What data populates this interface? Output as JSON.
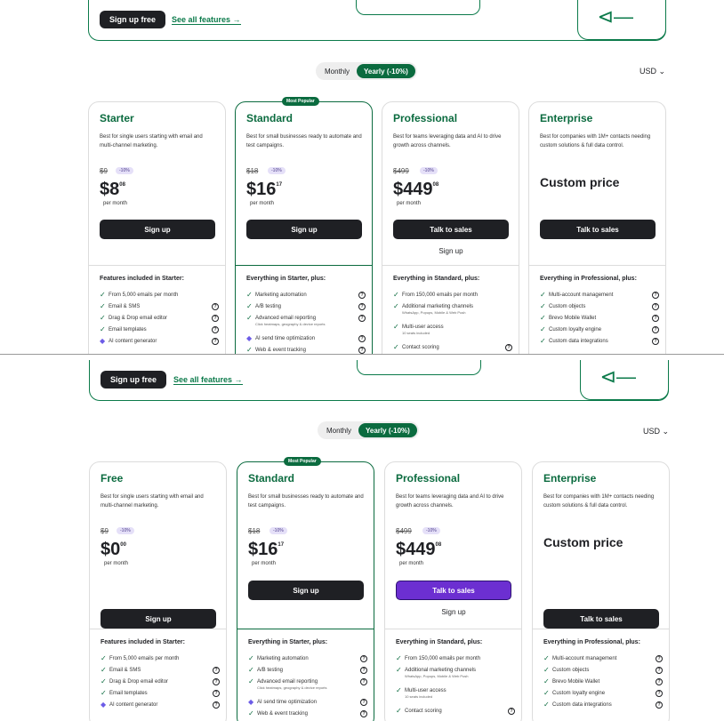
{
  "hero": {
    "signup_label": "Sign up free",
    "features_link": "See all features →"
  },
  "billing_toggle": {
    "monthly": "Monthly",
    "yearly": "Yearly (-10%)"
  },
  "currency": "USD",
  "popular_badge": "Most Popular",
  "top_plans": [
    {
      "name": "Starter",
      "desc": "Best for single users starting with email and multi-channel marketing.",
      "old": "$9",
      "disc": "-10%",
      "price": "$8",
      "cents": "08",
      "per": "per month",
      "cta": "Sign up",
      "ftitle": "Features included in Starter:",
      "features": [
        {
          "text": "From 5,000 emails per month",
          "sub": "",
          "info": ""
        },
        {
          "text": "Email & SMS",
          "sub": "",
          "info": "?"
        },
        {
          "text": "Drag & Drop email editor",
          "sub": "",
          "info": "?"
        },
        {
          "text": "Email templates",
          "sub": "",
          "info": "?"
        },
        {
          "text": "AI content generator",
          "sub": "",
          "info": "?"
        }
      ]
    },
    {
      "name": "Standard",
      "desc": "Best for small businesses ready to automate and test campaigns.",
      "old": "$18",
      "disc": "-10%",
      "price": "$16",
      "cents": "17",
      "per": "per month",
      "cta": "Sign up",
      "ftitle": "Everything in Starter, plus:",
      "features": [
        {
          "text": "Marketing automation",
          "sub": "",
          "info": "?"
        },
        {
          "text": "A/B testing",
          "sub": "",
          "info": "?"
        },
        {
          "text": "Advanced email reporting",
          "sub": "Click heatmaps, geography & device reports",
          "info": "?"
        },
        {
          "text": "AI send time optimization",
          "sub": "",
          "info": "?"
        },
        {
          "text": "Web & event tracking",
          "sub": "",
          "info": "?"
        }
      ]
    },
    {
      "name": "Professional",
      "desc": "Best for teams leveraging data and AI to drive growth across channels.",
      "old": "$499",
      "disc": "-10%",
      "price": "$449",
      "cents": "08",
      "per": "per month",
      "cta": "Talk to sales",
      "cta2": "Sign up",
      "ftitle": "Everything in Standard, plus:",
      "features": [
        {
          "text": "From 150,000 emails per month",
          "sub": "",
          "info": ""
        },
        {
          "text": "Additional marketing channels",
          "sub": "WhatsApp, Popups, Mobile & Web Push",
          "info": ""
        },
        {
          "text": "Multi-user access",
          "sub": "10 seats included",
          "info": ""
        },
        {
          "text": "Contact scoring",
          "sub": "",
          "info": "?"
        }
      ]
    },
    {
      "name": "Enterprise",
      "desc": "Best for companies with 1M+ contacts needing custom solutions & full data control.",
      "custom": "Custom price",
      "cta": "Talk to sales",
      "ftitle": "Everything in Professional, plus:",
      "features": [
        {
          "text": "Multi-account management",
          "sub": "",
          "info": "?"
        },
        {
          "text": "Custom objects",
          "sub": "",
          "info": "?"
        },
        {
          "text": "Brevo Mobile Wallet",
          "sub": "",
          "info": "?"
        },
        {
          "text": "Custom loyalty engine",
          "sub": "",
          "info": "?"
        },
        {
          "text": "Custom data integrations",
          "sub": "",
          "info": "?"
        }
      ]
    }
  ],
  "bottom_plans": [
    {
      "name": "Free",
      "desc": "Best for single users starting with email and multi-channel marketing.",
      "old": "$9",
      "disc": "-10%",
      "price": "$0",
      "cents": "00",
      "per": "per month",
      "cta": "Sign up",
      "ftitle": "Features included in Starter:",
      "features": [
        {
          "text": "From 5,000 emails per month",
          "sub": "",
          "info": ""
        },
        {
          "text": "Email & SMS",
          "sub": "",
          "info": "?"
        },
        {
          "text": "Drag & Drop email editor",
          "sub": "",
          "info": "?"
        },
        {
          "text": "Email templates",
          "sub": "",
          "info": "?"
        },
        {
          "text": "AI content generator",
          "sub": "",
          "info": "?"
        }
      ]
    },
    {
      "name": "Standard",
      "desc": "Best for small businesses ready to automate and test campaigns.",
      "old": "$18",
      "disc": "-10%",
      "price": "$16",
      "cents": "17",
      "per": "per month",
      "cta": "Sign up",
      "ftitle": "Everything in Starter, plus:",
      "features": [
        {
          "text": "Marketing automation",
          "sub": "",
          "info": "?"
        },
        {
          "text": "A/B testing",
          "sub": "",
          "info": "?"
        },
        {
          "text": "Advanced email reporting",
          "sub": "Click heatmaps, geography & device reports",
          "info": "?"
        },
        {
          "text": "AI send time optimization",
          "sub": "",
          "info": "?"
        },
        {
          "text": "Web & event tracking",
          "sub": "",
          "info": "?"
        }
      ]
    },
    {
      "name": "Professional",
      "desc": "Best for teams leveraging data and AI to drive growth across channels.",
      "old": "$499",
      "disc": "-10%",
      "price": "$449",
      "cents": "08",
      "per": "per month",
      "cta": "Talk to sales",
      "cta2": "Sign up",
      "ftitle": "Everything in Standard, plus:",
      "features": [
        {
          "text": "From 150,000 emails per month",
          "sub": "",
          "info": ""
        },
        {
          "text": "Additional marketing channels",
          "sub": "WhatsApp, Popups, Mobile & Web Push",
          "info": ""
        },
        {
          "text": "Multi-user access",
          "sub": "10 seats included",
          "info": ""
        },
        {
          "text": "Contact scoring",
          "sub": "",
          "info": "?"
        }
      ]
    },
    {
      "name": "Enterprise",
      "desc": "Best for companies with 1M+ contacts needing custom solutions & full data control.",
      "custom": "Custom price",
      "cta": "Talk to sales",
      "ftitle": "Everything in Professional, plus:",
      "features": [
        {
          "text": "Multi-account management",
          "sub": "",
          "info": "?"
        },
        {
          "text": "Custom objects",
          "sub": "",
          "info": "?"
        },
        {
          "text": "Brevo Mobile Wallet",
          "sub": "",
          "info": "?"
        },
        {
          "text": "Custom loyalty engine",
          "sub": "",
          "info": "?"
        },
        {
          "text": "Custom data integrations",
          "sub": "",
          "info": "?"
        }
      ]
    }
  ],
  "colors": {
    "brand_green": "#0b6b3f",
    "dark": "#1f2024",
    "purple_cta": "#6c2fd1",
    "discount_bg": "#e5e0f8"
  },
  "icons": {
    "check": "checkmark-icon",
    "ai": "ai-sparkle-icon",
    "info": "info-icon",
    "chevron": "chevron-down-icon",
    "arrow": "arrow-left-icon"
  }
}
